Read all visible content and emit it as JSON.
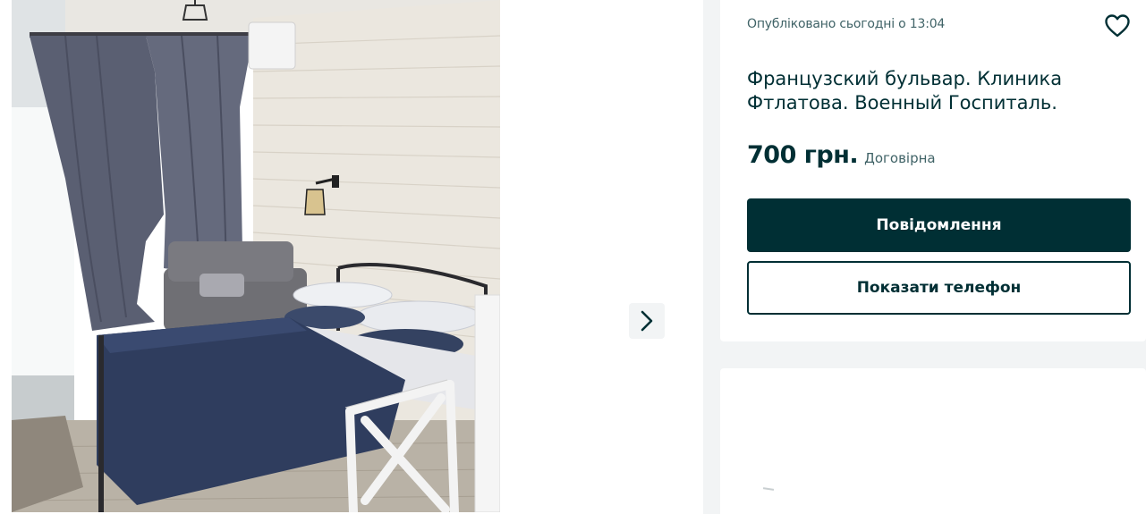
{
  "gallery": {
    "photo": {
      "icon": "bedroom-photo"
    },
    "next_button": {
      "icon": "chevron-right-icon"
    }
  },
  "listing": {
    "posted": "Опубліковано сьогодні о 13:04",
    "favorite_icon": "heart-icon",
    "title": "Французский бульвар. Клиника Фтлатова. Военный Госпиталь.",
    "price": "700 грн.",
    "price_note": "Договірна",
    "message_button": "Повідомлення",
    "phone_button": "Показати телефон"
  },
  "colors": {
    "primary": "#002f34",
    "muted_text": "#406367",
    "side_background": "#f2f4f5"
  }
}
